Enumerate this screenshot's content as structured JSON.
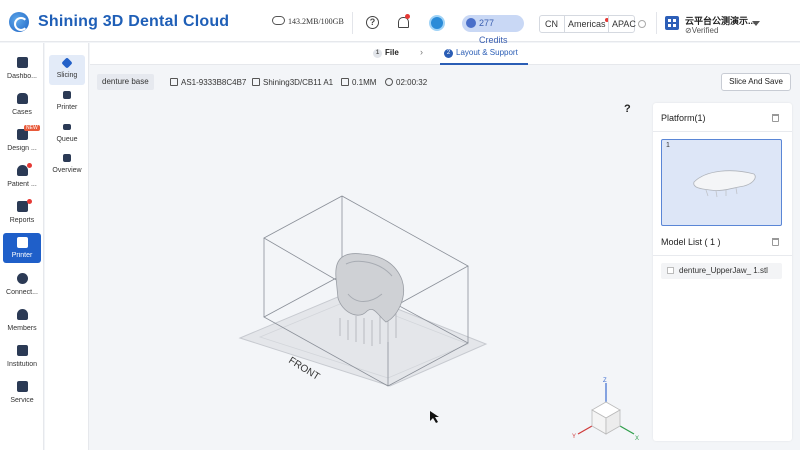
{
  "header": {
    "brand": "Shining 3D Dental Cloud",
    "storage": "143.2MB/100GB",
    "credits": "277 Credits",
    "regions": [
      "CN",
      "Americas",
      "APAC"
    ],
    "org_name": "云平台公测演示...",
    "org_status": "Verified"
  },
  "sidebar": {
    "items": [
      {
        "label": "Dashbo...",
        "icon": "dashboard-icon"
      },
      {
        "label": "Cases",
        "icon": "tooth-icon"
      },
      {
        "label": "Design ...",
        "icon": "design-icon",
        "badge": "NEW"
      },
      {
        "label": "Patient ...",
        "icon": "patient-icon"
      },
      {
        "label": "Reports",
        "icon": "reports-icon"
      },
      {
        "label": "Printer",
        "icon": "printer-icon",
        "active": true
      },
      {
        "label": "Connect...",
        "icon": "connect-icon"
      },
      {
        "label": "Members",
        "icon": "members-icon"
      },
      {
        "label": "Institution",
        "icon": "institution-icon"
      },
      {
        "label": "Service",
        "icon": "service-icon"
      }
    ]
  },
  "subsidebar": {
    "items": [
      {
        "label": "Slicing",
        "active": true
      },
      {
        "label": "Printer"
      },
      {
        "label": "Queue"
      },
      {
        "label": "Overview"
      }
    ]
  },
  "steps": {
    "step1_num": "1",
    "step1_label": "File",
    "arrow": "›",
    "step2_num": "2",
    "step2_label": "Layout & Support"
  },
  "infobar": {
    "tag": "denture base",
    "id": "AS1-9333B8C4B7",
    "machine": "Shining3D/CB11 A1",
    "layer": "0.1MM",
    "time": "02:00:32",
    "slice_button": "Slice And Save"
  },
  "viewport": {
    "help": "?",
    "front_label": "FRONT",
    "axis_x": "X",
    "axis_y": "Y",
    "axis_z": "Z"
  },
  "right_panel": {
    "platform_title": "Platform(1)",
    "platform_number": "1",
    "model_list_title": "Model List ( 1 )",
    "model_file": "denture_UpperJaw_ 1.stl"
  }
}
